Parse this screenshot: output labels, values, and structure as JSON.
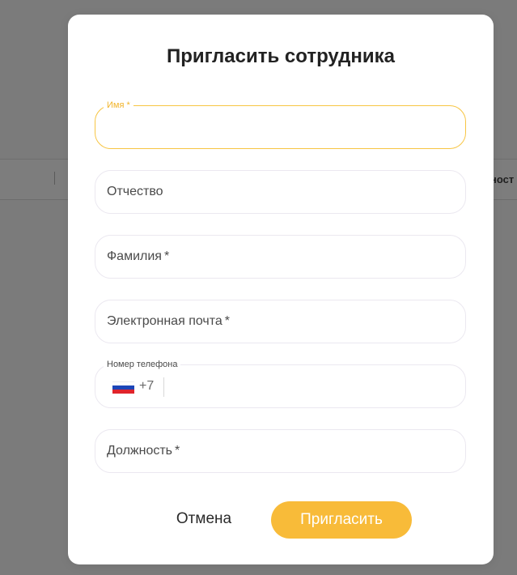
{
  "background": {
    "column_header_partial": "ност"
  },
  "modal": {
    "title": "Пригласить сотрудника",
    "fields": {
      "first_name": {
        "label": "Имя",
        "required_mark": "*",
        "value": ""
      },
      "patronymic": {
        "label": "Отчество",
        "value": ""
      },
      "last_name": {
        "label": "Фамилия",
        "required_mark": "*",
        "value": ""
      },
      "email": {
        "label": "Электронная почта",
        "required_mark": "*",
        "value": ""
      },
      "phone": {
        "label": "Номер телефона",
        "country_code": "+7",
        "flag": "russia-flag-icon",
        "value": ""
      },
      "position": {
        "label": "Должность",
        "required_mark": "*",
        "value": ""
      }
    },
    "buttons": {
      "cancel": "Отмена",
      "invite": "Пригласить"
    }
  },
  "colors": {
    "accent": "#f8bb39",
    "active_border": "#f7c543",
    "overlay": "#7b7b7b"
  }
}
